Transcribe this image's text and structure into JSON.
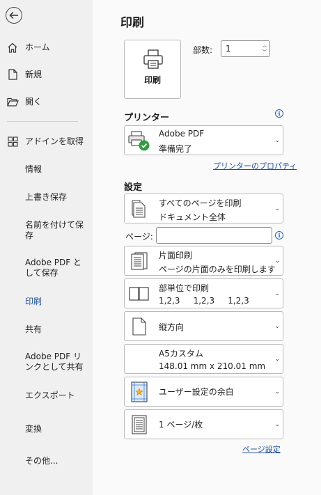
{
  "sidebar": {
    "items": [
      {
        "label": "ホーム",
        "icon": "home-icon"
      },
      {
        "label": "新規",
        "icon": "new-document-icon"
      },
      {
        "label": "開く",
        "icon": "open-folder-icon"
      },
      {
        "label": "アドインを取得",
        "icon": "addins-icon"
      },
      {
        "label": "情報"
      },
      {
        "label": "上書き保存"
      },
      {
        "label": "名前を付けて保\n存"
      },
      {
        "label": "Adobe PDF と\nして保存"
      },
      {
        "label": "印刷",
        "active": true
      },
      {
        "label": "共有"
      },
      {
        "label": "Adobe PDF リ\nンクとして共有"
      },
      {
        "label": "エクスポート"
      },
      {
        "label": "変換"
      },
      {
        "label": "その他..."
      }
    ]
  },
  "main": {
    "title": "印刷",
    "print_button_label": "印刷",
    "copies_label": "部数:",
    "copies_value": "1",
    "printer_section_title": "プリンター",
    "printer": {
      "name": "Adobe PDF",
      "status": "準備完了"
    },
    "printer_properties_link": "プリンターのプロパティ",
    "settings_section_title": "設定",
    "settings": [
      {
        "title": "すべてのページを印刷",
        "subtitle": "ドキュメント全体",
        "icon": "pages-icon"
      },
      {
        "title": "片面印刷",
        "subtitle": "ページの片面のみを印刷します",
        "icon": "single-sided-icon"
      },
      {
        "title": "部単位で印刷",
        "subtitle": "1,2,3     1,2,3     1,2,3",
        "icon": "collate-icon"
      },
      {
        "title": "縦方向",
        "subtitle": "",
        "icon": "portrait-icon"
      },
      {
        "title": "A5カスタム",
        "subtitle": "148.01 mm x 210.01 mm",
        "icon": "paper-size-icon"
      },
      {
        "title": "ユーザー設定の余白",
        "subtitle": "",
        "icon": "margins-icon"
      },
      {
        "title": "1 ページ/枚",
        "subtitle": "",
        "icon": "pages-per-sheet-icon"
      }
    ],
    "pages_label": "ページ:",
    "pages_value": "",
    "page_setup_link": "ページ設定"
  },
  "colors": {
    "accent": "#1f4e99",
    "info": "#1f5fb8",
    "check_green": "#2e9e3f"
  }
}
